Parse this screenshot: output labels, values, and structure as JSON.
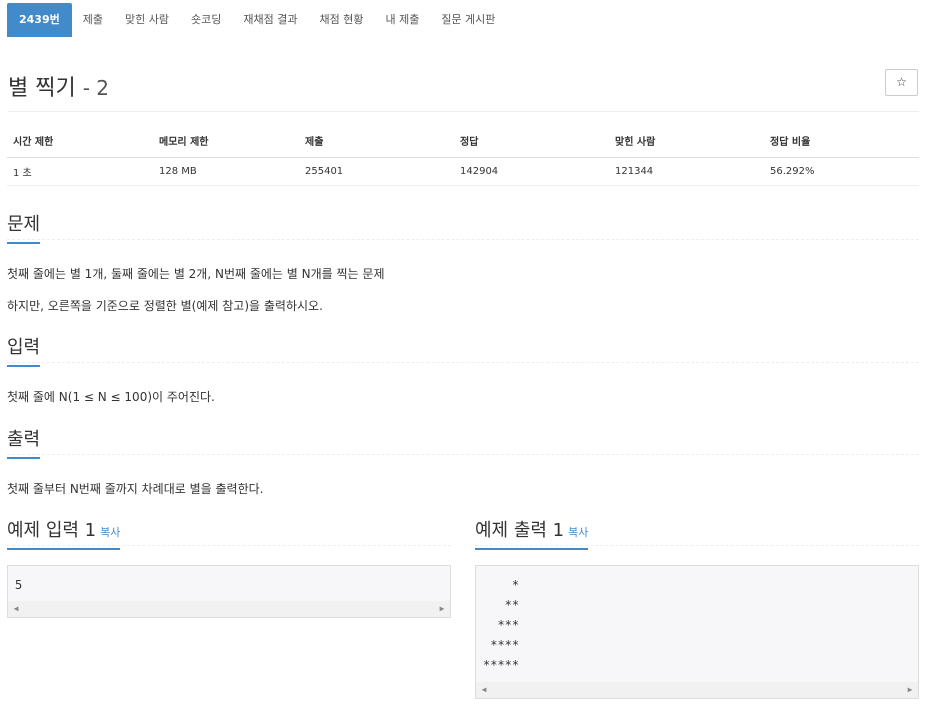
{
  "tabs": [
    {
      "label": "2439번",
      "active": true
    },
    {
      "label": "제출"
    },
    {
      "label": "맞힌 사람"
    },
    {
      "label": "숏코딩"
    },
    {
      "label": "재채점 결과"
    },
    {
      "label": "채점 현황"
    },
    {
      "label": "내 제출"
    },
    {
      "label": "질문 게시판"
    }
  ],
  "problem": {
    "title": "별 찍기",
    "subtitle": "- 2",
    "star_glyph": "☆"
  },
  "info_table": {
    "headers": [
      "시간 제한",
      "메모리 제한",
      "제출",
      "정답",
      "맞힌 사람",
      "정답 비율"
    ],
    "row": [
      "1 초",
      "128 MB",
      "255401",
      "142904",
      "121344",
      "56.292%"
    ]
  },
  "sections": {
    "description": {
      "heading": "문제",
      "lines": [
        "첫째 줄에는 별 1개, 둘째 줄에는 별 2개, N번째 줄에는 별 N개를 찍는 문제",
        "하지만, 오른쪽을 기준으로 정렬한 별(예제 참고)을 출력하시오."
      ]
    },
    "input": {
      "heading": "입력",
      "lines": [
        "첫째 줄에 N(1 ≤ N ≤ 100)이 주어진다."
      ]
    },
    "output": {
      "heading": "출력",
      "lines": [
        "첫째 줄부터 N번째 줄까지 차례대로 별을 출력한다."
      ]
    }
  },
  "examples": {
    "input": {
      "heading": "예제 입력 1",
      "copy_label": "복사",
      "content": "5"
    },
    "output": {
      "heading": "예제 출력 1",
      "copy_label": "복사",
      "content": "    *\n   **\n  ***\n ****\n*****"
    }
  },
  "colors": {
    "accent": "#428bca"
  },
  "icons": {
    "scroll_left": "◀",
    "scroll_right": "▶"
  }
}
